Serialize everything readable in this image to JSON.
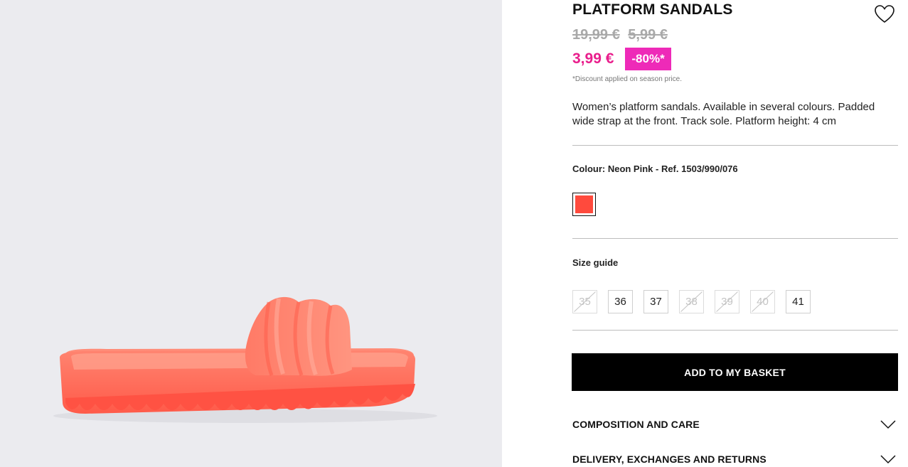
{
  "product": {
    "title": "PLATFORM SANDALS",
    "old_price_1": "19,99 €",
    "old_price_2": "5,99 €",
    "sale_price": "3,99 €",
    "discount_badge": "-80%*",
    "discount_note": "*Discount applied on season price.",
    "description": "Women’s platform sandals. Available in several colours. Padded wide strap at the front. Track sole. Platform height: 4 cm",
    "colour_label": "Colour: Neon Pink - Ref. 1503/990/076",
    "swatch_color": "#ff4a3d",
    "sandal_color": "#ff6f5c",
    "sale_color": "#e91e8c",
    "badge_color": "#ee2ab8"
  },
  "sizes": {
    "guide_label": "Size guide",
    "options": [
      {
        "label": "35",
        "available": false
      },
      {
        "label": "36",
        "available": true
      },
      {
        "label": "37",
        "available": true
      },
      {
        "label": "38",
        "available": false
      },
      {
        "label": "39",
        "available": false
      },
      {
        "label": "40",
        "available": false
      },
      {
        "label": "41",
        "available": true
      }
    ]
  },
  "actions": {
    "add_to_basket": "ADD TO MY BASKET"
  },
  "accordions": [
    {
      "label": "COMPOSITION AND CARE",
      "icon": "chevron-down-icon"
    },
    {
      "label": "DELIVERY, EXCHANGES AND RETURNS",
      "icon": "chevron-down-icon"
    }
  ],
  "icons": {
    "wishlist": "heart-icon"
  }
}
